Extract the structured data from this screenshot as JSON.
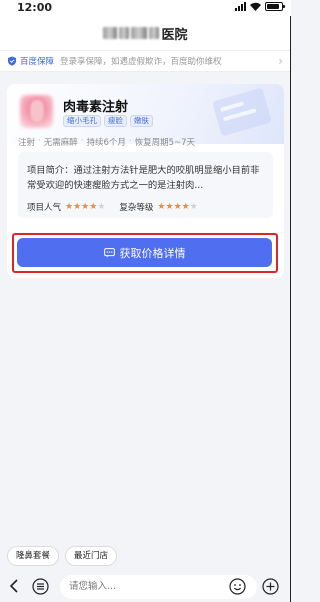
{
  "status_bar": {
    "time": "12:00"
  },
  "header": {
    "hospital_suffix": "医院"
  },
  "guarantee": {
    "brand": "百度保障",
    "text": "登录享保障，如遇虚假欺诈，百度助你维权",
    "arrow": "›"
  },
  "item_card": {
    "title": "肉毒素注射",
    "tags": [
      "缩小毛孔",
      "瘦脸",
      "嫩肤"
    ],
    "attributes": [
      "注射",
      "无需麻醉",
      "持续6个月",
      "恢复周期5~7天"
    ],
    "separator": "·",
    "intro": "项目简介：通过注射方法针是肥大的咬肌明显缩小目前非常受欢迎的快速瘦脸方式之一的是注射肉...",
    "popularity_label": "项目人气",
    "popularity_stars": 4,
    "complexity_label": "复杂等级",
    "complexity_stars": 4,
    "max_stars": 5,
    "star_color": "#f5892b"
  },
  "price_button": {
    "label": "获取价格详情",
    "color": "#4f6ef0"
  },
  "quick_chips": [
    "隆鼻套餐",
    "最近门店"
  ],
  "chat_input": {
    "placeholder": "请您输入..."
  }
}
